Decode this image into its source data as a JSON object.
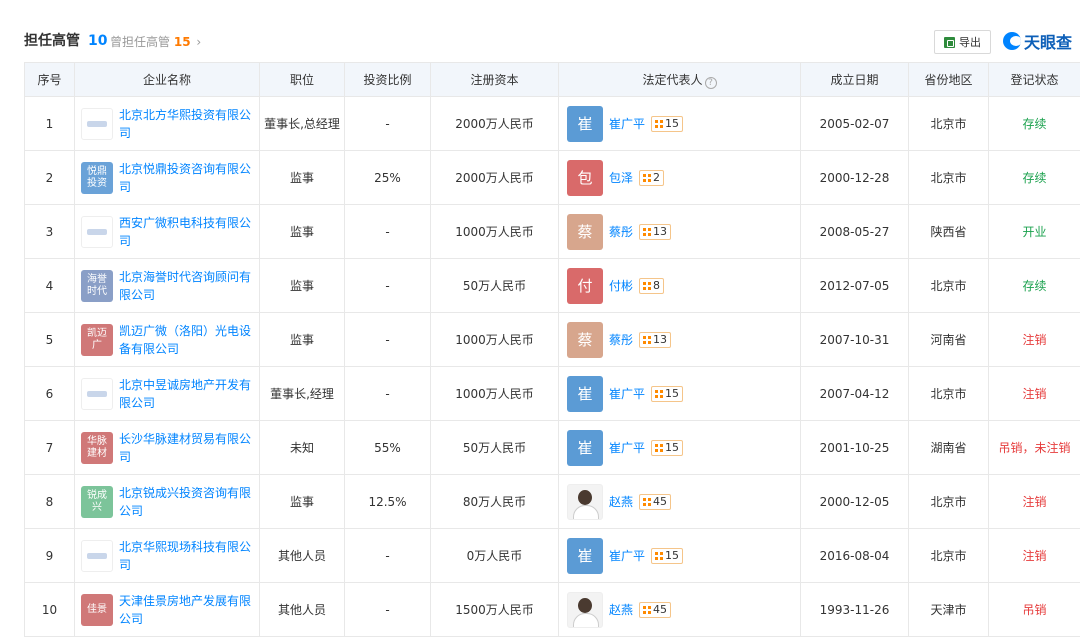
{
  "header": {
    "title": "担任高管",
    "count": "10",
    "past_label": "曾担任高管",
    "past_count": "15",
    "past_chevron": "›",
    "export_label": "导出",
    "brand": "天眼查"
  },
  "columns": {
    "index": "序号",
    "company": "企业名称",
    "position": "职位",
    "ratio": "投资比例",
    "capital": "注册资本",
    "legal_rep": "法定代表人",
    "help": "?",
    "date": "成立日期",
    "region": "省份地区",
    "status": "登记状态"
  },
  "colors": {
    "link": "#0084ff",
    "active": "#1aa14d",
    "cancelled": "#e63c3c",
    "count": "#ff7a00"
  },
  "rows": [
    {
      "index": "1",
      "logo": "",
      "logo_color": "#ffffff",
      "company": "北京北方华熙投资有限公司",
      "position": "董事长,总经理",
      "ratio": "-",
      "capital": "2000万人民币",
      "rep_char": "崔",
      "rep_color": "#5b9bd5",
      "rep_photo": false,
      "rep_name": "崔广平",
      "rep_count": "15",
      "date": "2005-02-07",
      "region": "北京市",
      "status": "存续",
      "status_color": "#1aa14d"
    },
    {
      "index": "2",
      "logo": "悦鼎投资",
      "logo_color": "#6aa2d8",
      "company": "北京悦鼎投资咨询有限公司",
      "position": "监事",
      "ratio": "25%",
      "capital": "2000万人民币",
      "rep_char": "包",
      "rep_color": "#d96a6a",
      "rep_photo": false,
      "rep_name": "包泽",
      "rep_count": "2",
      "date": "2000-12-28",
      "region": "北京市",
      "status": "存续",
      "status_color": "#1aa14d"
    },
    {
      "index": "3",
      "logo": "",
      "logo_color": "#ffffff",
      "company": "西安广微积电科技有限公司",
      "position": "监事",
      "ratio": "-",
      "capital": "1000万人民币",
      "rep_char": "蔡",
      "rep_color": "#d7a68d",
      "rep_photo": false,
      "rep_name": "蔡彤",
      "rep_count": "13",
      "date": "2008-05-27",
      "region": "陕西省",
      "status": "开业",
      "status_color": "#1aa14d"
    },
    {
      "index": "4",
      "logo": "海誉时代",
      "logo_color": "#8a9fc7",
      "company": "北京海誉时代咨询顾问有限公司",
      "position": "监事",
      "ratio": "-",
      "capital": "50万人民币",
      "rep_char": "付",
      "rep_color": "#d96a6a",
      "rep_photo": false,
      "rep_name": "付彬",
      "rep_count": "8",
      "date": "2012-07-05",
      "region": "北京市",
      "status": "存续",
      "status_color": "#1aa14d"
    },
    {
      "index": "5",
      "logo": "凯迈广",
      "logo_color": "#d07878",
      "company": "凯迈广微（洛阳）光电设备有限公司",
      "position": "监事",
      "ratio": "-",
      "capital": "1000万人民币",
      "rep_char": "蔡",
      "rep_color": "#d7a68d",
      "rep_photo": false,
      "rep_name": "蔡彤",
      "rep_count": "13",
      "date": "2007-10-31",
      "region": "河南省",
      "status": "注销",
      "status_color": "#e63c3c"
    },
    {
      "index": "6",
      "logo": "",
      "logo_color": "#ffffff",
      "company": "北京中昱诚房地产开发有限公司",
      "position": "董事长,经理",
      "ratio": "-",
      "capital": "1000万人民币",
      "rep_char": "崔",
      "rep_color": "#5b9bd5",
      "rep_photo": false,
      "rep_name": "崔广平",
      "rep_count": "15",
      "date": "2007-04-12",
      "region": "北京市",
      "status": "注销",
      "status_color": "#e63c3c"
    },
    {
      "index": "7",
      "logo": "华脉建材",
      "logo_color": "#d07878",
      "company": "长沙华脉建材贸易有限公司",
      "position": "未知",
      "ratio": "55%",
      "capital": "50万人民币",
      "rep_char": "崔",
      "rep_color": "#5b9bd5",
      "rep_photo": false,
      "rep_name": "崔广平",
      "rep_count": "15",
      "date": "2001-10-25",
      "region": "湖南省",
      "status": "吊销，未注销",
      "status_color": "#e63c3c"
    },
    {
      "index": "8",
      "logo": "锐成兴",
      "logo_color": "#7cc49a",
      "company": "北京锐成兴投资咨询有限公司",
      "position": "监事",
      "ratio": "12.5%",
      "capital": "80万人民币",
      "rep_char": "",
      "rep_color": "#f3f3f3",
      "rep_photo": true,
      "rep_name": "赵燕",
      "rep_count": "45",
      "date": "2000-12-05",
      "region": "北京市",
      "status": "注销",
      "status_color": "#e63c3c"
    },
    {
      "index": "9",
      "logo": "",
      "logo_color": "#ffffff",
      "company": "北京华熙现场科技有限公司",
      "position": "其他人员",
      "ratio": "-",
      "capital": "0万人民币",
      "rep_char": "崔",
      "rep_color": "#5b9bd5",
      "rep_photo": false,
      "rep_name": "崔广平",
      "rep_count": "15",
      "date": "2016-08-04",
      "region": "北京市",
      "status": "注销",
      "status_color": "#e63c3c"
    },
    {
      "index": "10",
      "logo": "佳景",
      "logo_color": "#d07878",
      "company": "天津佳景房地产发展有限公司",
      "position": "其他人员",
      "ratio": "-",
      "capital": "1500万人民币",
      "rep_char": "",
      "rep_color": "#f3f3f3",
      "rep_photo": true,
      "rep_name": "赵燕",
      "rep_count": "45",
      "date": "1993-11-26",
      "region": "天津市",
      "status": "吊销",
      "status_color": "#e63c3c"
    }
  ]
}
